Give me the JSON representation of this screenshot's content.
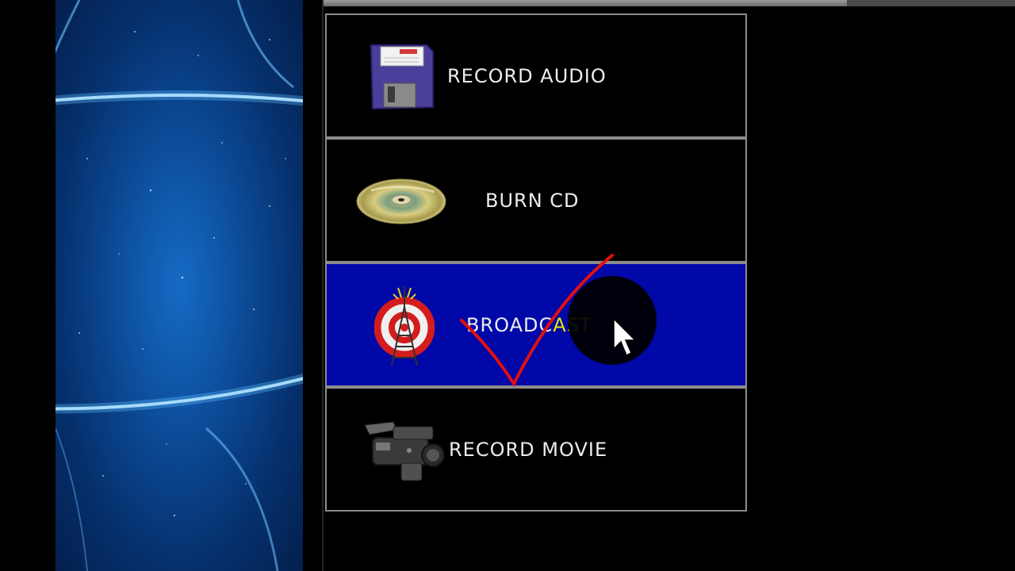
{
  "menu": {
    "items": [
      {
        "label": "RECORD AUDIO",
        "icon": "floppy-disk-icon",
        "active": false
      },
      {
        "label": "BURN CD",
        "icon": "cd-disc-icon",
        "active": false
      },
      {
        "label_plain": "BROADCAST",
        "label_part1": "BROAD",
        "label_part2": "C",
        "label_part3": "AST",
        "icon": "broadcast-tower-icon",
        "active": true
      },
      {
        "label": "RECORD MOVIE",
        "icon": "video-camera-icon",
        "active": false
      }
    ]
  },
  "colors": {
    "active_background": "#0008a8",
    "label_text": "#ececec",
    "highlight_text": "#e6e600",
    "checkmark": "#e01010",
    "item_border": "#8c8c8c"
  }
}
